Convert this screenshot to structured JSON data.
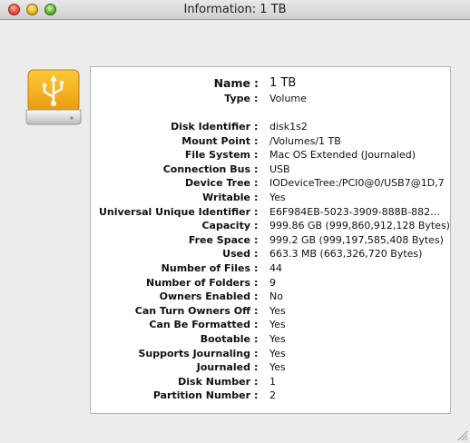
{
  "window": {
    "title": "Information: 1 TB"
  },
  "icon": "usb-drive-icon",
  "name_row": {
    "label": "Name",
    "value": "1 TB"
  },
  "type_row": {
    "label": "Type",
    "value": "Volume"
  },
  "properties": [
    {
      "label": "Disk Identifier",
      "value": "disk1s2"
    },
    {
      "label": "Mount Point",
      "value": "/Volumes/1 TB"
    },
    {
      "label": "File System",
      "value": "Mac OS Extended (Journaled)"
    },
    {
      "label": "Connection Bus",
      "value": "USB"
    },
    {
      "label": "Device Tree",
      "value": "IODeviceTree:/PCI0@0/USB7@1D,7"
    },
    {
      "label": "Writable",
      "value": "Yes"
    },
    {
      "label": "Universal Unique Identifier",
      "value": "E6F984EB-5023-3909-888B-882…"
    },
    {
      "label": "Capacity",
      "value": "999.86 GB (999,860,912,128 Bytes)"
    },
    {
      "label": "Free Space",
      "value": "999.2 GB (999,197,585,408 Bytes)"
    },
    {
      "label": "Used",
      "value": "663.3 MB (663,326,720 Bytes)"
    },
    {
      "label": "Number of Files",
      "value": "44"
    },
    {
      "label": "Number of Folders",
      "value": "9"
    },
    {
      "label": "Owners Enabled",
      "value": "No"
    },
    {
      "label": "Can Turn Owners Off",
      "value": "Yes"
    },
    {
      "label": "Can Be Formatted",
      "value": "Yes"
    },
    {
      "label": "Bootable",
      "value": "Yes"
    },
    {
      "label": "Supports Journaling",
      "value": "Yes"
    },
    {
      "label": "Journaled",
      "value": "Yes"
    },
    {
      "label": "Disk Number",
      "value": "1"
    },
    {
      "label": "Partition Number",
      "value": "2"
    }
  ],
  "separator": ":"
}
